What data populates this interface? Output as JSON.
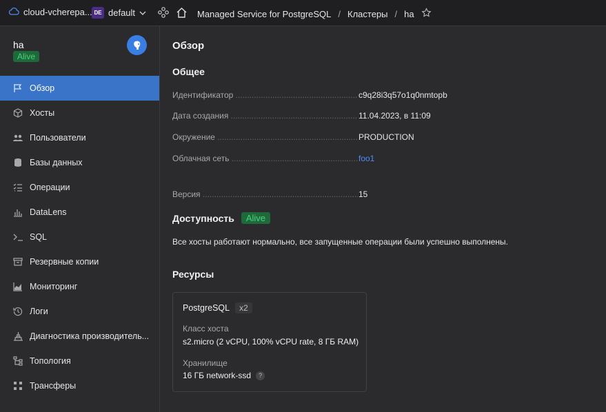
{
  "topbar": {
    "cloud_name": "cloud-vcherepa...",
    "org_badge": "DE",
    "folder": "default",
    "breadcrumbs": [
      "Managed Service for PostgreSQL",
      "Кластеры",
      "ha"
    ]
  },
  "sidebar": {
    "title": "ha",
    "status": "Alive",
    "items": [
      {
        "label": "Обзор",
        "icon": "flag-icon",
        "active": true
      },
      {
        "label": "Хосты",
        "icon": "cube-icon"
      },
      {
        "label": "Пользователи",
        "icon": "users-icon"
      },
      {
        "label": "Базы данных",
        "icon": "database-icon"
      },
      {
        "label": "Операции",
        "icon": "list-check-icon"
      },
      {
        "label": "DataLens",
        "icon": "bar-chart-icon"
      },
      {
        "label": "SQL",
        "icon": "terminal-icon"
      },
      {
        "label": "Резервные копии",
        "icon": "archive-icon"
      },
      {
        "label": "Мониторинг",
        "icon": "area-chart-icon"
      },
      {
        "label": "Логи",
        "icon": "history-icon"
      },
      {
        "label": "Диагностика производитель...",
        "icon": "diagnostics-icon"
      },
      {
        "label": "Топология",
        "icon": "topology-icon"
      },
      {
        "label": "Трансферы",
        "icon": "transfer-icon"
      }
    ]
  },
  "main": {
    "title": "Обзор",
    "general_title": "Общее",
    "props": [
      {
        "key": "Идентификатор",
        "value": "c9q28i3q57o1q0nmtopb"
      },
      {
        "key": "Дата создания",
        "value": "11.04.2023, в 11:09"
      },
      {
        "key": "Окружение",
        "value": "PRODUCTION"
      },
      {
        "key": "Облачная сеть",
        "value": "foo1"
      }
    ],
    "version_key": "Версия",
    "version_value": "15",
    "availability_title": "Доступность",
    "availability_status": "Alive",
    "status_text": "Все хосты работают нормально, все запущенные операции были успешно выполнены.",
    "resources_title": "Ресурсы",
    "resource_card": {
      "name": "PostgreSQL",
      "count": "x2",
      "host_class_label": "Класс хоста",
      "host_class_value": "s2.micro (2 vCPU, 100% vCPU rate, 8 ГБ RAM)",
      "storage_label": "Хранилище",
      "storage_value": "16 ГБ network-ssd",
      "help": "?"
    }
  },
  "colors": {
    "accent": "#3a74c8",
    "status_green": "#4bd07e",
    "link": "#4e8ef0"
  }
}
